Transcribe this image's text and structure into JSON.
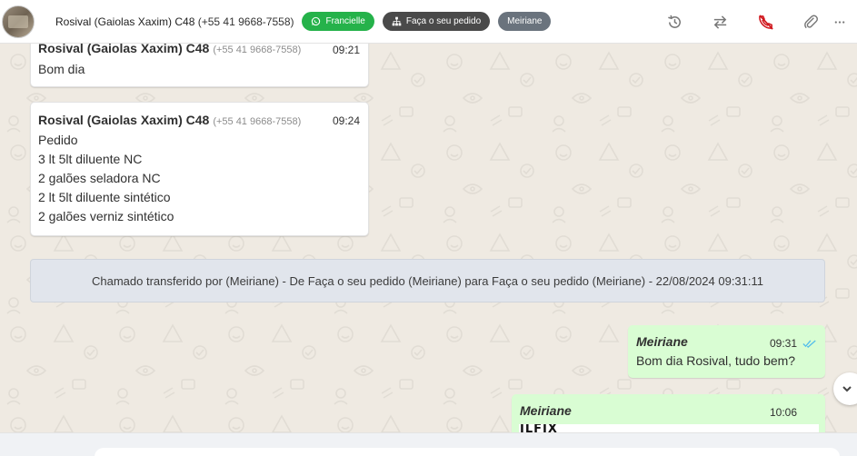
{
  "header": {
    "contact_name": "Rosival (Gaiolas Xaxim) C48",
    "contact_phone": "(+55 41 9668-7558)",
    "tags": [
      {
        "label": "Francielle",
        "icon": "whatsapp-icon",
        "color": "#25b24a"
      },
      {
        "label": "Faça o seu pedido",
        "icon": "sitemap-icon",
        "color": "#4a4a4a"
      },
      {
        "label": "Meiriane",
        "icon": "",
        "color": "#6a737d"
      }
    ],
    "actions": [
      "history-icon",
      "transfer-icon",
      "end-call-icon",
      "attachment-icon",
      "more-icon"
    ]
  },
  "messages": [
    {
      "sender": "Rosival (Gaiolas Xaxim) C48",
      "phone": "(+55 41 9668-7558)",
      "time": "09:21",
      "lines": [
        "Bom dia"
      ]
    },
    {
      "sender": "Rosival (Gaiolas Xaxim) C48",
      "phone": "(+55 41 9668-7558)",
      "time": "09:24",
      "lines": [
        "Pedido",
        "3 lt 5lt diluente NC",
        "2 galões seladora NC",
        "2 lt 5lt diluente sintético",
        "2 galões verniz sintético"
      ]
    }
  ],
  "system_message": "Chamado transferido por (Meiriane) - De Faça o seu pedido (Meiriane) para Faça o seu pedido (Meiriane) - 22/08/2024 09:31:11",
  "outgoing": [
    {
      "sender": "Meiriane",
      "time": "09:31",
      "text": "Bom dia Rosival, tudo bem?",
      "status": "read"
    },
    {
      "sender": "Meiriane",
      "time": "10:06",
      "image_logo_text": "ILFIX"
    }
  ],
  "colors": {
    "outgoing_bubble": "#d9fdd3",
    "incoming_bubble": "#ffffff",
    "read_ticks": "#53bdeb",
    "end_call": "#d0161c",
    "chat_background": "#efeae2"
  }
}
